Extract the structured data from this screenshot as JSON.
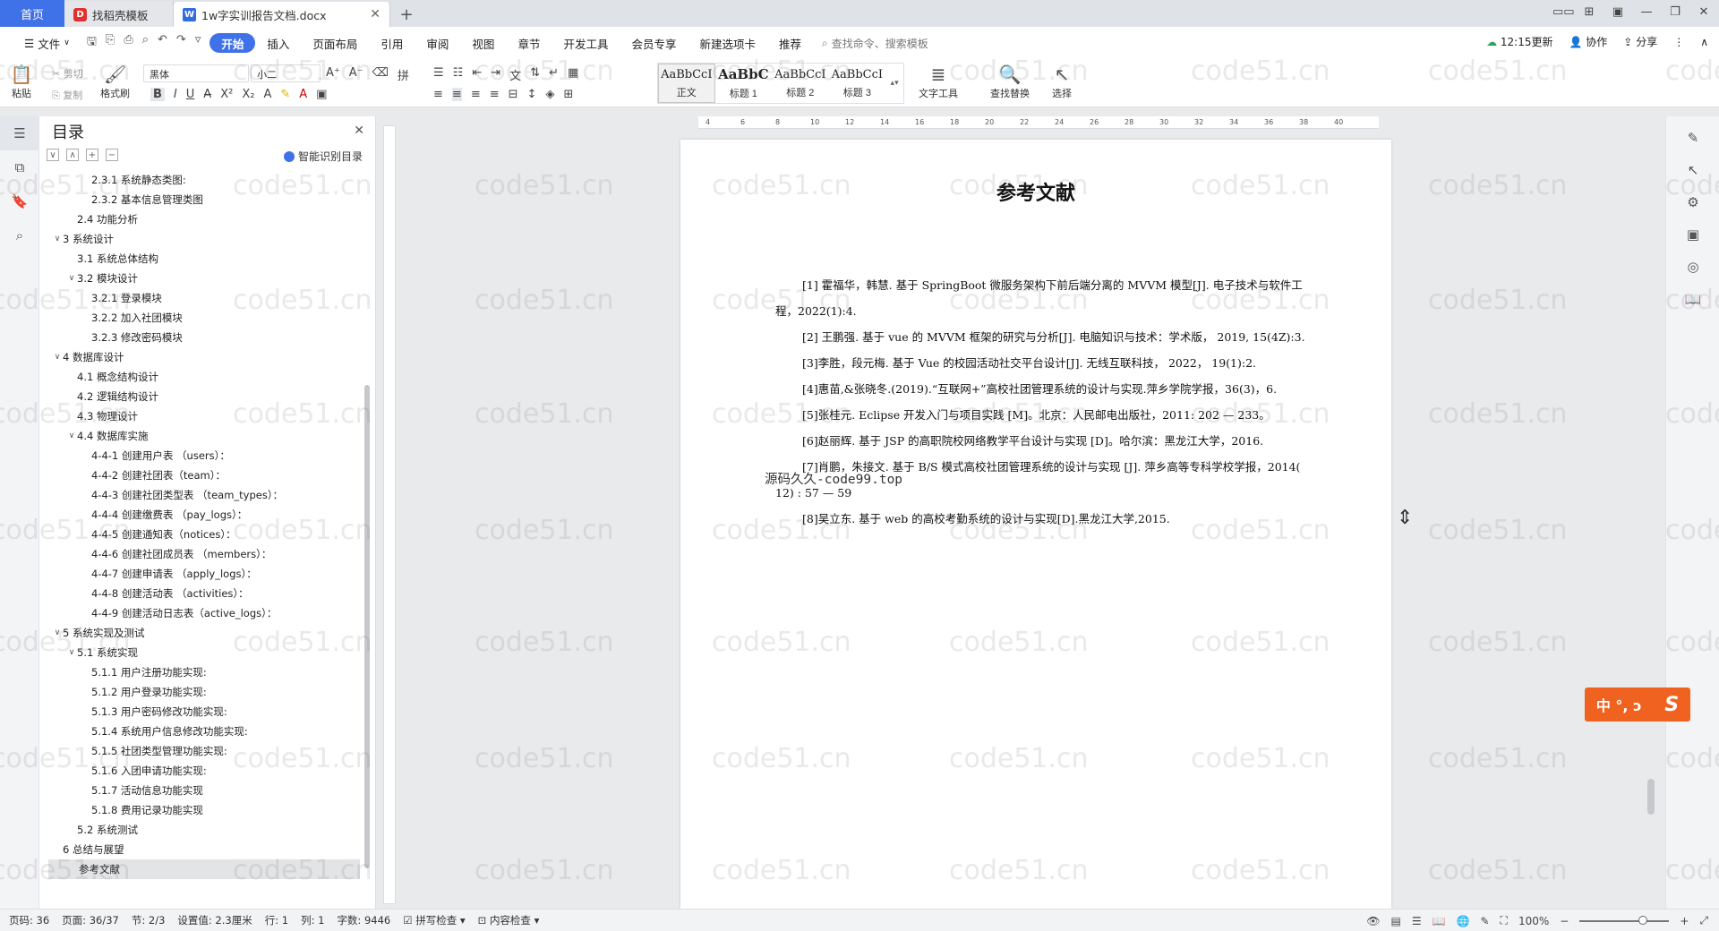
{
  "tabs": {
    "home": "首页",
    "template": "找稻壳模板",
    "doc": "1w字实训报告文档.docx"
  },
  "window_controls": [
    "▭▭",
    "⊞",
    "▣",
    "—",
    "❐",
    "✕"
  ],
  "menu": {
    "file": "文件",
    "items": [
      "开始",
      "插入",
      "页面布局",
      "引用",
      "审阅",
      "视图",
      "章节",
      "开发工具",
      "会员专享",
      "新建选项卡",
      "推荐"
    ],
    "search": "查找命令、搜索模板",
    "sync": "12:15更新",
    "collab": "协作",
    "share": "分享"
  },
  "ribbon": {
    "paste": "粘贴",
    "cut": "剪切",
    "copy": "复制",
    "format_painter": "格式刷",
    "font_name": "黑体",
    "font_size": "小二",
    "styles": [
      {
        "sample": "AaBbCcI",
        "label": "正文"
      },
      {
        "sample": "AaBbC",
        "label": "标题 1"
      },
      {
        "sample": "AaBbCcI",
        "label": "标题 2"
      },
      {
        "sample": "AaBbCcI",
        "label": "标题 3"
      }
    ],
    "text_tools": "文字工具",
    "find_replace": "查找替换",
    "select": "选择"
  },
  "toc": {
    "title": "目录",
    "smart": "智能识别目录",
    "items": [
      {
        "level": 3,
        "text": "2.3.1 系统静态类图:"
      },
      {
        "level": 3,
        "text": "2.3.2 基本信息管理类图"
      },
      {
        "level": 2,
        "text": "2.4 功能分析"
      },
      {
        "level": 1,
        "text": "3  系统设计",
        "arrow": "∨"
      },
      {
        "level": 2,
        "text": "3.1 系统总体结构"
      },
      {
        "level": 2,
        "text": "3.2 模块设计",
        "arrow": "∨"
      },
      {
        "level": 3,
        "text": "3.2.1 登录模块"
      },
      {
        "level": 3,
        "text": "3.2.2 加入社团模块"
      },
      {
        "level": 3,
        "text": "3.2.3 修改密码模块"
      },
      {
        "level": 1,
        "text": "4  数据库设计",
        "arrow": "∨"
      },
      {
        "level": 2,
        "text": "4.1 概念结构设计"
      },
      {
        "level": 2,
        "text": "4.2 逻辑结构设计"
      },
      {
        "level": 2,
        "text": "4.3 物理设计"
      },
      {
        "level": 2,
        "text": "4.4  数据库实施",
        "arrow": "∨"
      },
      {
        "level": 3,
        "text": "4-4-1 创建用户表  （users）："
      },
      {
        "level": 3,
        "text": "4-4-2 创建社团表（team）："
      },
      {
        "level": 3,
        "text": "4-4-3 创建社团类型表  （team_types）："
      },
      {
        "level": 3,
        "text": "4-4-4 创建缴费表  （pay_logs）："
      },
      {
        "level": 3,
        "text": "4-4-5 创建通知表（notices）："
      },
      {
        "level": 3,
        "text": "4-4-6 创建社团成员表  （members）："
      },
      {
        "level": 3,
        "text": "4-4-7  创建申请表  （apply_logs）："
      },
      {
        "level": 3,
        "text": "4-4-8 创建活动表  （activities）："
      },
      {
        "level": 3,
        "text": "4-4-9 创建活动日志表（active_logs）："
      },
      {
        "level": 1,
        "text": "5  系统实现及测试",
        "arrow": "∨"
      },
      {
        "level": 2,
        "text": "5.1 系统实现",
        "arrow": "∨"
      },
      {
        "level": 3,
        "text": "5.1.1 用户注册功能实现:"
      },
      {
        "level": 3,
        "text": "5.1.2 用户登录功能实现:"
      },
      {
        "level": 3,
        "text": "5.1.3 用户密码修改功能实现:"
      },
      {
        "level": 3,
        "text": "5.1.4 系统用户信息修改功能实现:"
      },
      {
        "level": 3,
        "text": "5.1.5 社团类型管理功能实现:"
      },
      {
        "level": 3,
        "text": "5.1.6 入团申请功能实现:"
      },
      {
        "level": 3,
        "text": "5.1.7  活动信息功能实现"
      },
      {
        "level": 3,
        "text": "5.1.8 费用记录功能实现"
      },
      {
        "level": 2,
        "text": "5.2  系统测试"
      },
      {
        "level": 1,
        "text": "6 总结与展望"
      },
      {
        "level": 1,
        "text": "参考文献",
        "selected": true
      }
    ]
  },
  "document": {
    "title": "参考文献",
    "references": [
      "[1] 霍福华，韩慧. 基于 SpringBoot 微服务架构下前后端分离的 MVVM 模型[J]. 电子技术与软件工程，2022(1):4.",
      "[2] 王鹏强. 基于 vue 的 MVVM 框架的研究与分析[J]. 电脑知识与技术：学术版， 2019, 15(4Z):3.",
      "[3]李胜，段元梅. 基于 Vue 的校园活动社交平台设计[J]. 无线互联科技， 2022， 19(1):2.",
      "[4]惠苗,&张晓冬.(2019).“互联网+”高校社团管理系统的设计与实现.萍乡学院学报，36(3)，6.",
      "[5]张桂元. Eclipse 开发入门与项目实践 [M]。北京：人民邮电出版社，2011: 202 — 233。",
      "[6]赵丽辉. 基于 JSP 的高职院校网络教学平台设计与实现 [D]。哈尔滨：黑龙江大学，2016.",
      "[7]肖鹏，朱接文. 基于 B/S 模式高校社团管理系统的设计与实现 [J]. 萍乡高等专科学校学报，2014( 12) : 57 — 59",
      "[8]吴立东. 基于 web 的高校考勤系统的设计与实现[D].黑龙江大学,2015."
    ],
    "overlay_text": "源码久久-code99.top"
  },
  "watermark": "code51.cn",
  "ime": {
    "label": "中 °, ɔ",
    "logo": "S"
  },
  "status": {
    "page_num": "页码: 36",
    "pages": "页面: 36/37",
    "section": "节: 2/3",
    "setting": "设置值: 2.3厘米",
    "row": "行: 1",
    "col": "列: 1",
    "words": "字数: 9446",
    "spell": "拼写检查",
    "content_check": "内容检查",
    "zoom": "100%"
  },
  "colors": {
    "accent": "#3f72e8",
    "ime": "#f0621f"
  }
}
